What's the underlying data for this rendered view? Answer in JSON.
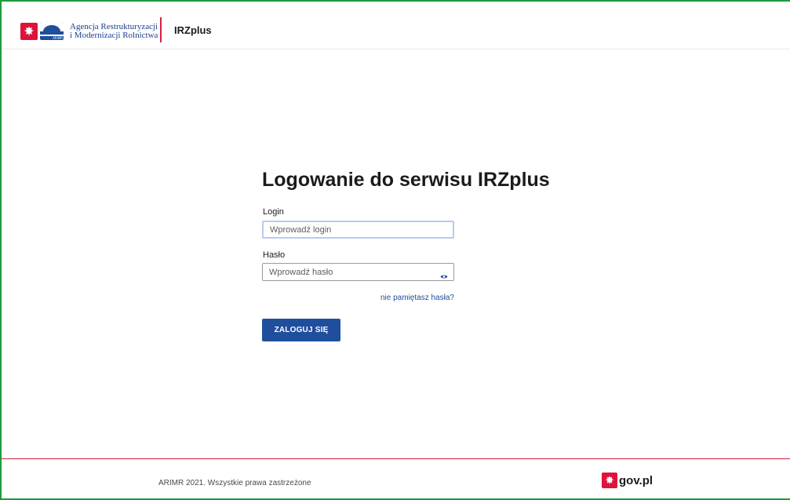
{
  "header": {
    "agency_line1": "Agencja Restrukturyzacji",
    "agency_line2": "i Modernizacji Rolnictwa",
    "logo_mark_text": "ARiMR",
    "app_name": "IRZplus"
  },
  "login_form": {
    "title": "Logowanie do serwisu IRZplus",
    "login_label": "Login",
    "login_placeholder": "Wprowadź login",
    "login_value": "",
    "password_label": "Hasło",
    "password_placeholder": "Wprowadź hasło",
    "password_value": "",
    "password_toggle_icon": "eye-icon",
    "forgot_link": "nie pamiętasz hasła?",
    "submit_label": "ZALOGUJ SIĘ"
  },
  "footer": {
    "copyright": "ARIMR 2021. Wszystkie prawa zastrzeżone",
    "gov_logo_text": "gov.pl"
  },
  "colors": {
    "primary": "#1f4e9c",
    "accent_red": "#d4213d",
    "frame_green": "#1f9b3c"
  }
}
